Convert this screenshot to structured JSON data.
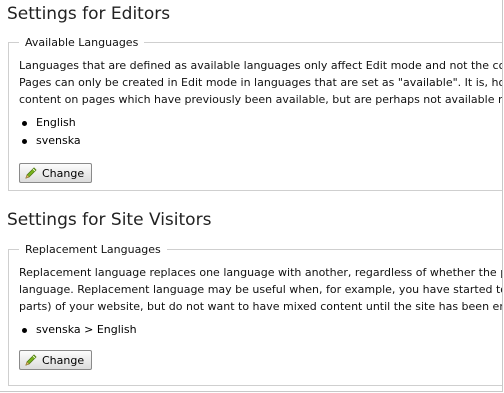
{
  "editors": {
    "title": "Settings for Editors",
    "legend": "Available Languages",
    "description_lines": [
      "Languages that are defined as available languages only affect Edit mode and not the content",
      "Pages can only be created in Edit mode in languages that are set as \"available\". It is, howeve",
      "content on pages which have previously been available, but are perhaps not available now."
    ],
    "languages": [
      "English",
      "svenska"
    ],
    "change_label": "Change",
    "button_icon": "pencil-icon"
  },
  "visitors": {
    "title": "Settings for Site Visitors",
    "legend": "Replacement Languages",
    "description_lines": [
      "Replacement language replaces one language with another, regardless of whether the page",
      "language. Replacement language may be useful when, for example, you have started to tran",
      "parts) of your website, but do not want to have mixed content until the site has been entirely"
    ],
    "replacements": [
      "svenska > English"
    ],
    "change_label": "Change",
    "button_icon": "pencil-icon"
  },
  "colors": {
    "pencil_body": "#7ab51d",
    "pencil_tip": "#e8c37a",
    "border": "#cfcfcf"
  }
}
